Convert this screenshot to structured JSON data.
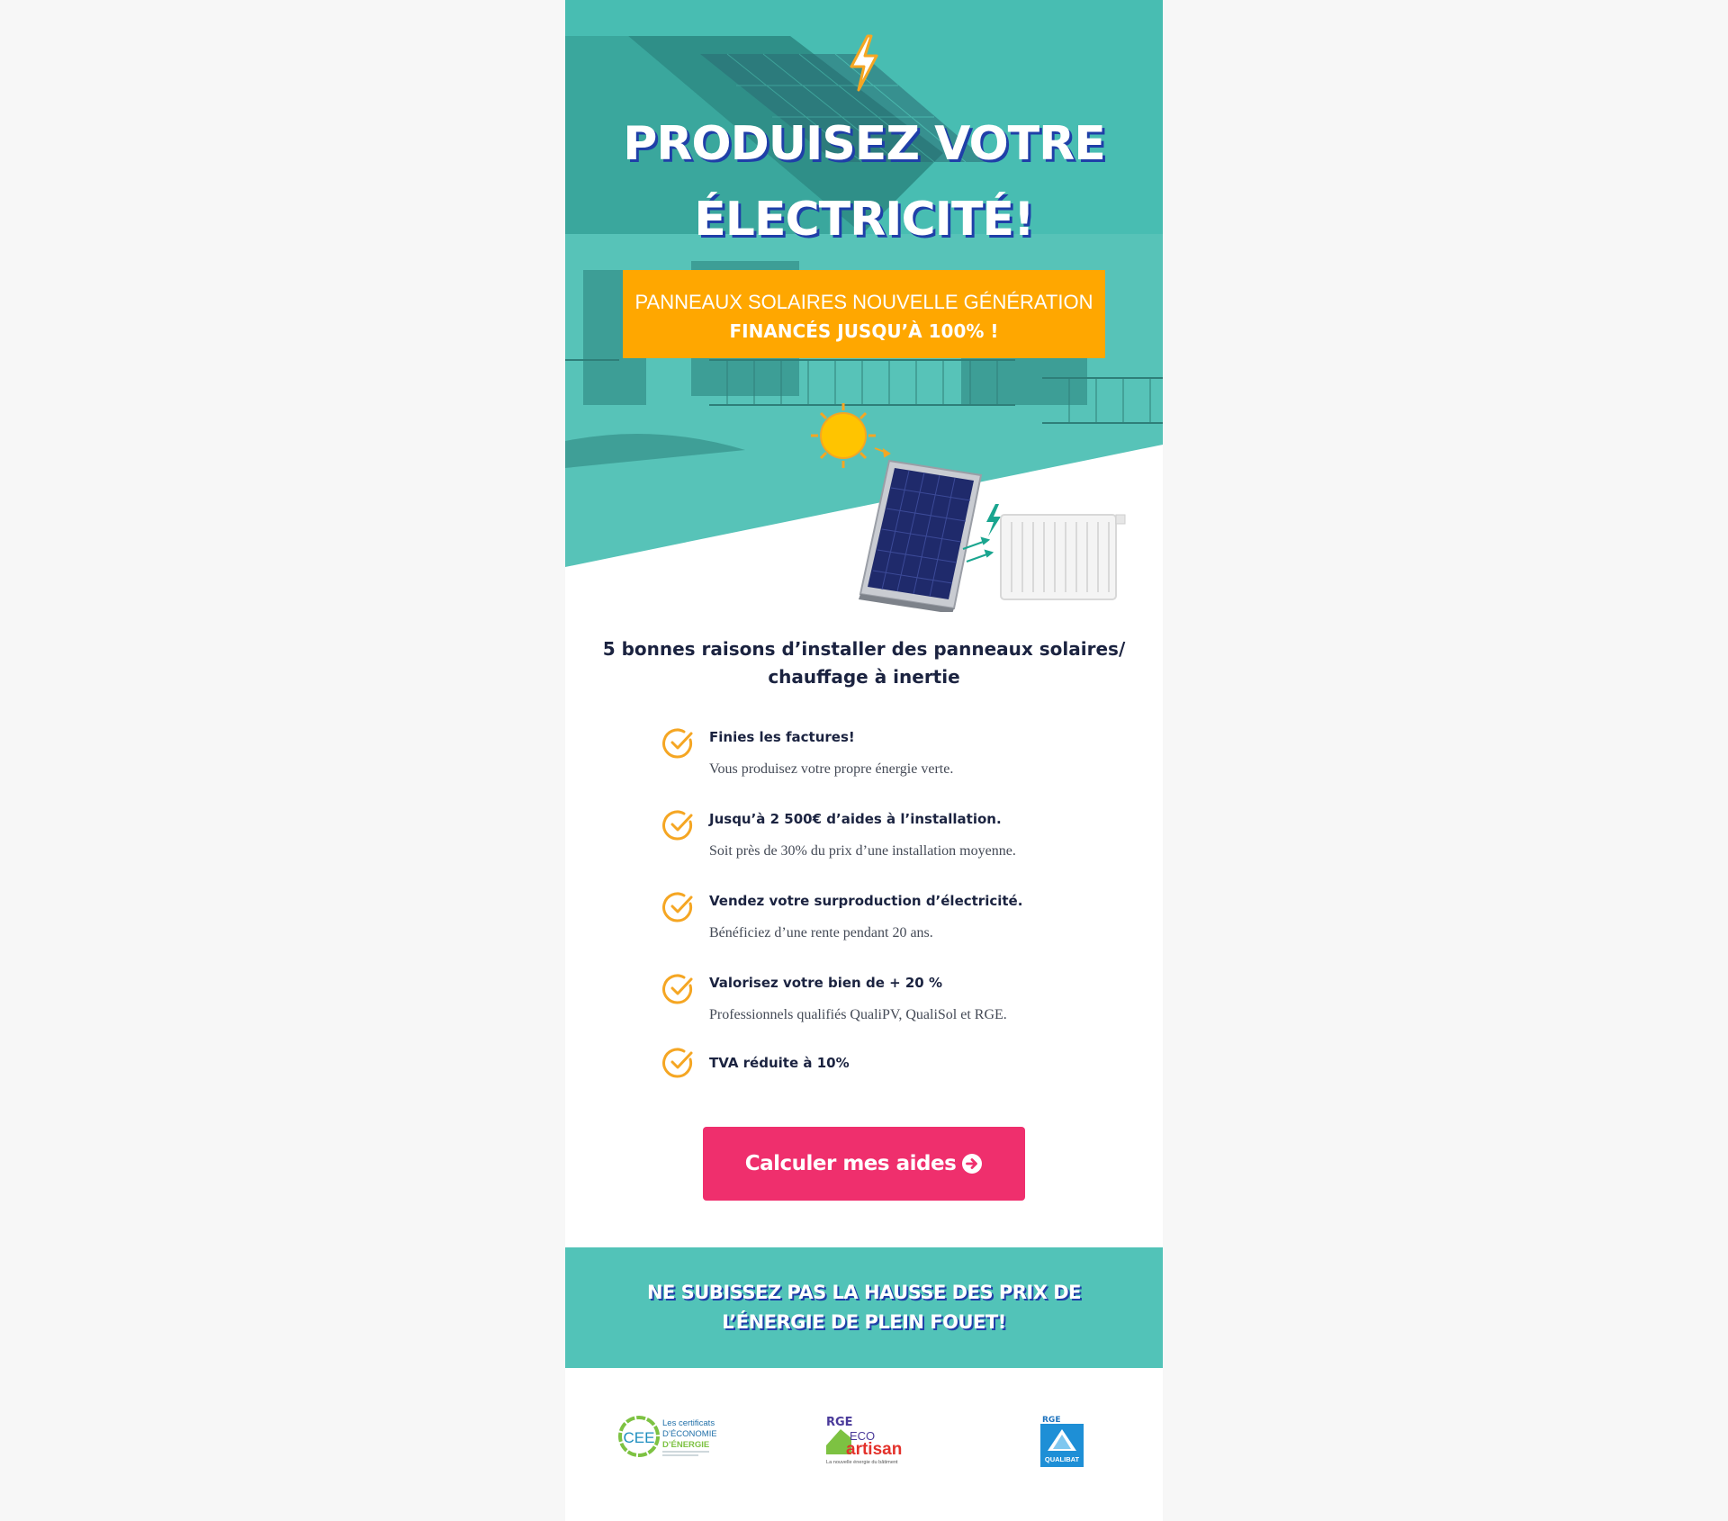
{
  "hero": {
    "title_line1": "PRODUISEZ VOTRE",
    "title_line2": "ÉLECTRICITÉ!",
    "promo_line1": "PANNEAUX SOLAIRES NOUVELLE GÉNÉRATION",
    "promo_line2": "FINANCÉS JUSQU’À 100% !",
    "icons": [
      "lightning-bolt-icon",
      "sun-icon",
      "solar-panel-image",
      "radiator-image"
    ]
  },
  "reasons": {
    "title_line1": "5 bonnes raisons d’installer des panneaux solaires/",
    "title_line2": "chauffage à inertie",
    "items": [
      {
        "title": "Finies les factures!",
        "desc": "Vous produisez votre propre énergie verte."
      },
      {
        "title": "Jusqu’à 2 500€ d’aides à l’installation.",
        "desc": "Soit près de 30% du prix d’une installation moyenne."
      },
      {
        "title": "Vendez votre surproduction d’électricité.",
        "desc": "Bénéficiez d’une rente pendant 20 ans."
      },
      {
        "title": "Valorisez votre bien de + 20 %",
        "desc": "Professionnels qualifiés QualiPV, QualiSol et RGE."
      },
      {
        "title": "TVA réduite à 10%",
        "desc": ""
      }
    ]
  },
  "cta": {
    "label": "Calculer mes aides",
    "icon": "arrow-circle-right-icon"
  },
  "banner": {
    "line1": "NE SUBISSEZ PAS LA HAUSSE DES PRIX DE",
    "line2": "L’ÉNERGIE DE PLEIN FOUET!"
  },
  "logos": {
    "cee": {
      "badge": "CEE",
      "text_line1": "Les certificats",
      "text_line2": "D’ÉCONOMIES",
      "text_line3": "D’ÉNERGIE"
    },
    "eco_artisan": {
      "badge": "RGE",
      "word1": "ECO",
      "word2": "artisan",
      "tagline": "La nouvelle énergie du bâtiment"
    },
    "qualibat": {
      "badge": "RGE",
      "name": "QUALIBAT"
    }
  },
  "colors": {
    "page_bg": "#f7f7f7",
    "hero_teal": "#3fb8b0",
    "promo_orange": "#ffa700",
    "check_orange": "#f5a623",
    "cta_pink": "#ef2f6d",
    "banner_teal": "#52c3b8",
    "text_navy": "#1b2340",
    "title_shadow_blue": "#1f3fa8"
  }
}
